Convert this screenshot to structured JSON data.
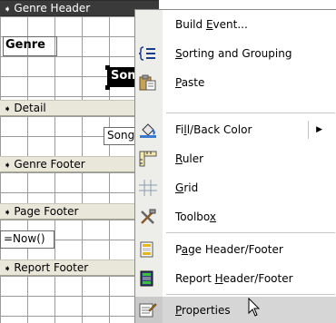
{
  "design": {
    "sections": {
      "genre_header": "Genre Header",
      "detail": "Detail",
      "genre_footer": "Genre Footer",
      "page_footer": "Page Footer",
      "report_footer": "Report Footer"
    },
    "controls": {
      "genre_label": "Genre",
      "song_label": "Song",
      "song_textbox": "Song",
      "now_textbox": "=Now()"
    }
  },
  "menu": {
    "items": [
      {
        "pre": "Build ",
        "key": "E",
        "post": "vent...",
        "icon": "build-event-icon"
      },
      {
        "pre": "",
        "key": "S",
        "post": "orting and Grouping",
        "icon": "sorting-grouping-icon"
      },
      {
        "pre": "",
        "key": "P",
        "post": "aste",
        "icon": "paste-icon"
      },
      {
        "pre": "Fi",
        "key": "l",
        "post": "l/Back Color",
        "icon": "fill-color-icon"
      },
      {
        "pre": "",
        "key": "R",
        "post": "uler",
        "icon": "ruler-icon"
      },
      {
        "pre": "",
        "key": "G",
        "post": "rid",
        "icon": "grid-icon"
      },
      {
        "pre": "Toolbo",
        "key": "x",
        "post": "",
        "icon": "toolbox-icon"
      },
      {
        "pre": "P",
        "key": "a",
        "post": "ge Header/Footer",
        "icon": "page-header-footer-icon"
      },
      {
        "pre": "Report ",
        "key": "H",
        "post": "eader/Footer",
        "icon": "report-header-footer-icon"
      },
      {
        "pre": "",
        "key": "P",
        "post": "roperties",
        "icon": "properties-icon"
      }
    ],
    "submenu_arrow": "▶"
  },
  "colors": {
    "band": "#e9e6da",
    "band_selected": "#3a3a3a",
    "menu_gutter": "#ededea",
    "highlight": "#d6d6d6"
  }
}
